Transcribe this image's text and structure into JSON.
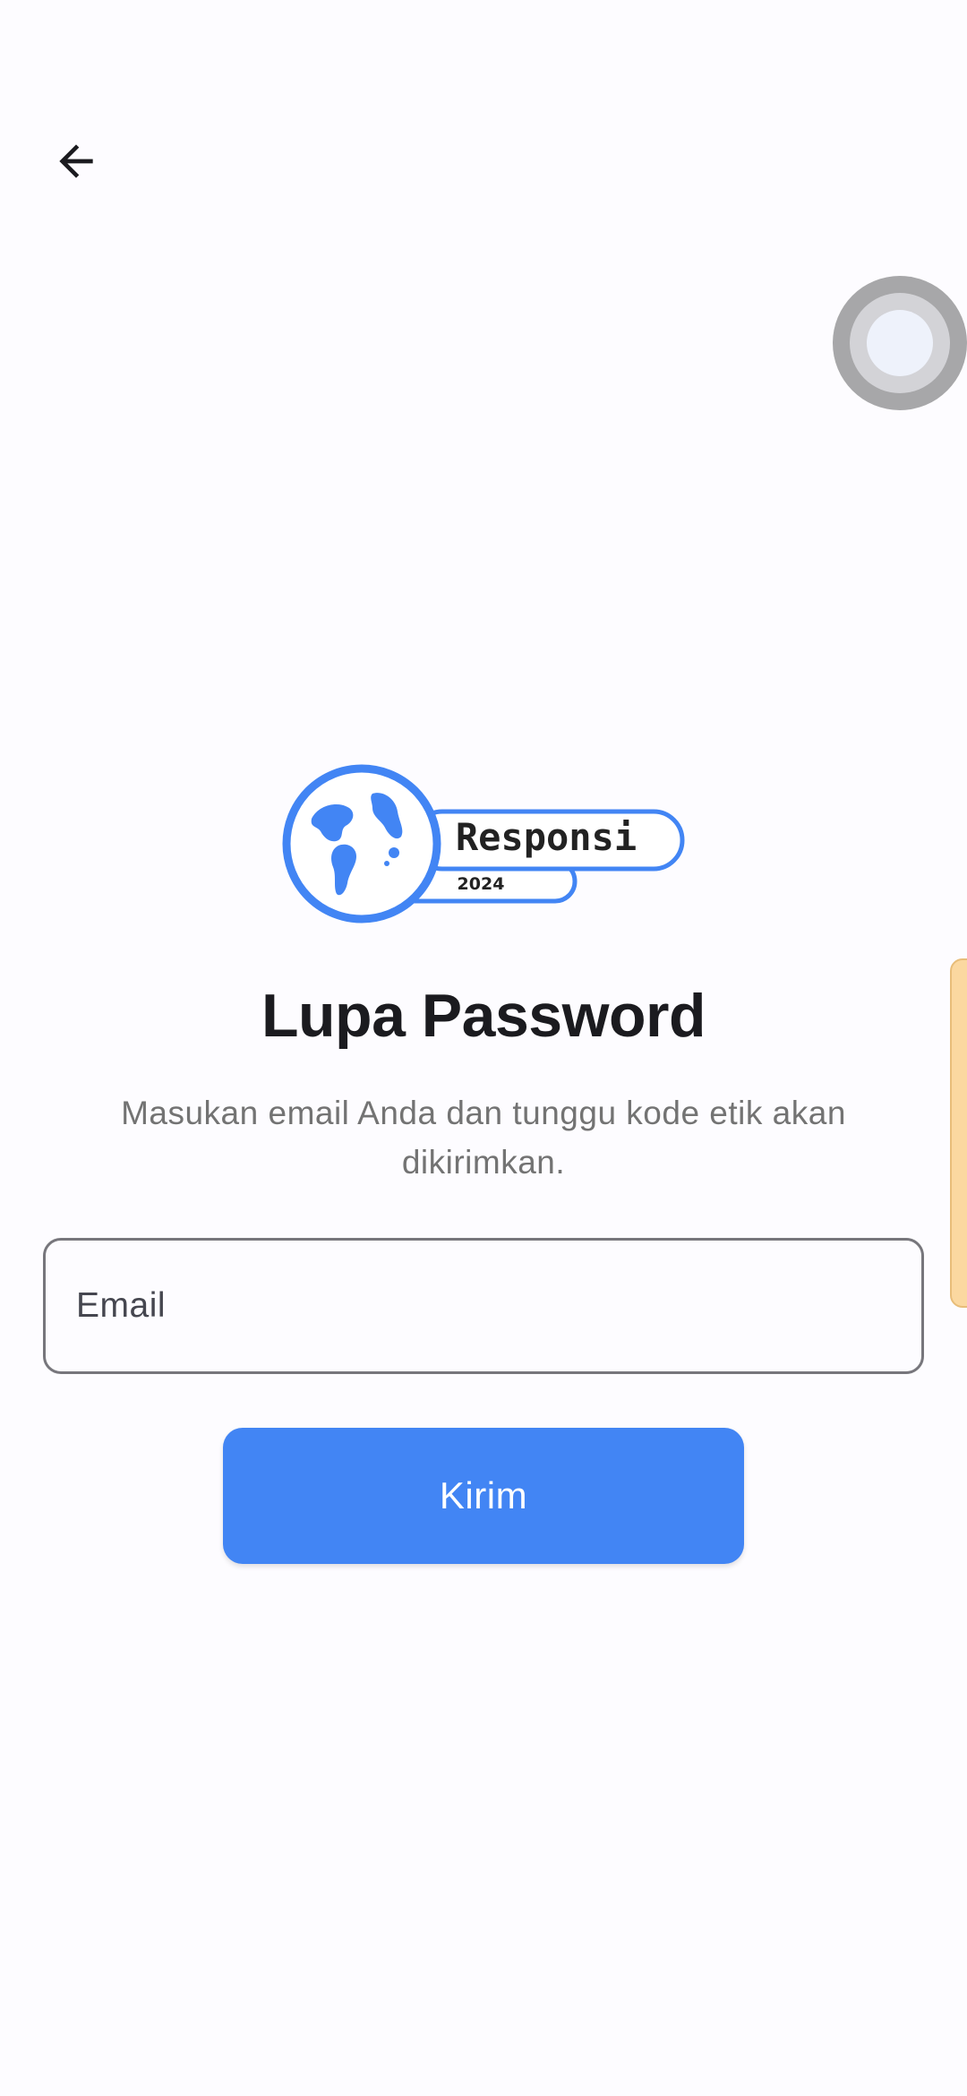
{
  "header": {
    "back_icon": "arrow-back-icon"
  },
  "overlay": {
    "assistive_touch_icon": "assistive-touch-icon",
    "edge_panel": "edge-panel-handle"
  },
  "logo": {
    "brand": "Responsi",
    "year": "2024",
    "icon": "globe-icon",
    "color": "#4285f4"
  },
  "page": {
    "title": "Lupa Password",
    "subtitle": "Masukan email Anda dan tunggu kode etik akan dikirimkan."
  },
  "form": {
    "email_placeholder": "Email",
    "email_value": "",
    "submit_label": "Kirim"
  },
  "colors": {
    "primary": "#4285f4",
    "title_text": "#1b1b1f",
    "subtitle_text": "#737373",
    "field_border": "#77767c",
    "background": "#fdfcff"
  }
}
